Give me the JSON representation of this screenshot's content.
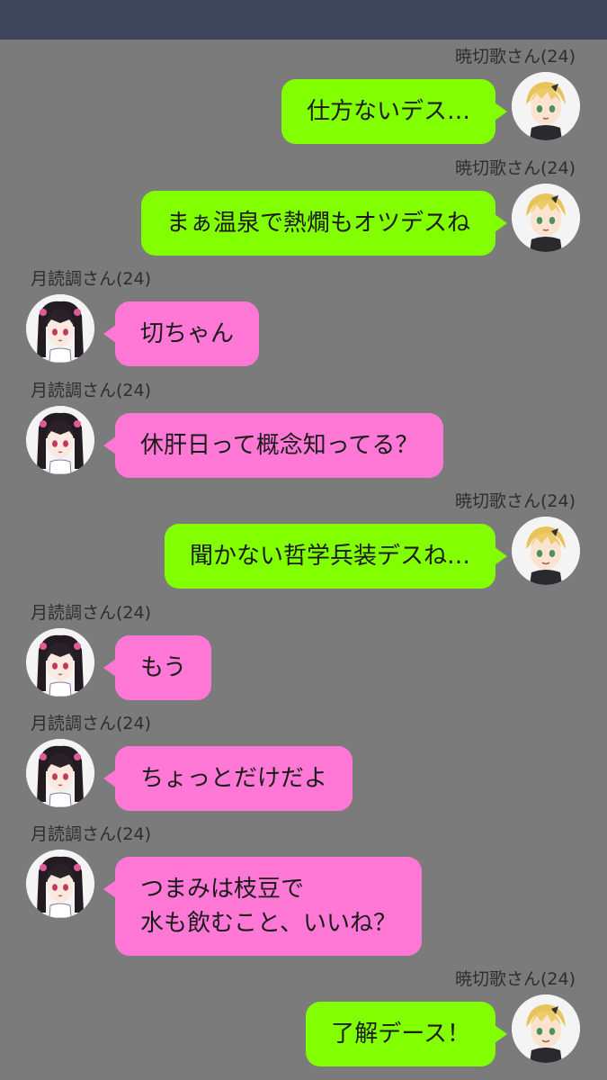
{
  "messages": [
    {
      "side": "right",
      "sender": "暁切歌さん(24)",
      "lines": [
        "仕方ないデス…"
      ]
    },
    {
      "side": "right",
      "sender": "暁切歌さん(24)",
      "lines": [
        "まぁ温泉で熱燗もオツデスね"
      ]
    },
    {
      "side": "left",
      "sender": "月読調さん(24)",
      "lines": [
        "切ちゃん"
      ]
    },
    {
      "side": "left",
      "sender": "月読調さん(24)",
      "lines": [
        "休肝日って概念知ってる？"
      ]
    },
    {
      "side": "right",
      "sender": "暁切歌さん(24)",
      "lines": [
        "聞かない哲学兵装デスね…"
      ]
    },
    {
      "side": "left",
      "sender": "月読調さん(24)",
      "lines": [
        "もう"
      ]
    },
    {
      "side": "left",
      "sender": "月読調さん(24)",
      "lines": [
        "ちょっとだけだよ"
      ]
    },
    {
      "side": "left",
      "sender": "月読調さん(24)",
      "lines": [
        "つまみは枝豆で",
        "水も飲むこと、いいね？"
      ]
    },
    {
      "side": "right",
      "sender": "暁切歌さん(24)",
      "lines": [
        "了解デース！"
      ]
    }
  ],
  "colors": {
    "background": "#7b7b7b",
    "topbar": "#3c4559",
    "right_bubble": "#82ff00",
    "left_bubble": "#ff78d6"
  },
  "icons": {
    "kirika_avatar": "blonde-character-avatar-icon",
    "shirabe_avatar": "dark-haired-twintail-character-avatar-icon"
  }
}
